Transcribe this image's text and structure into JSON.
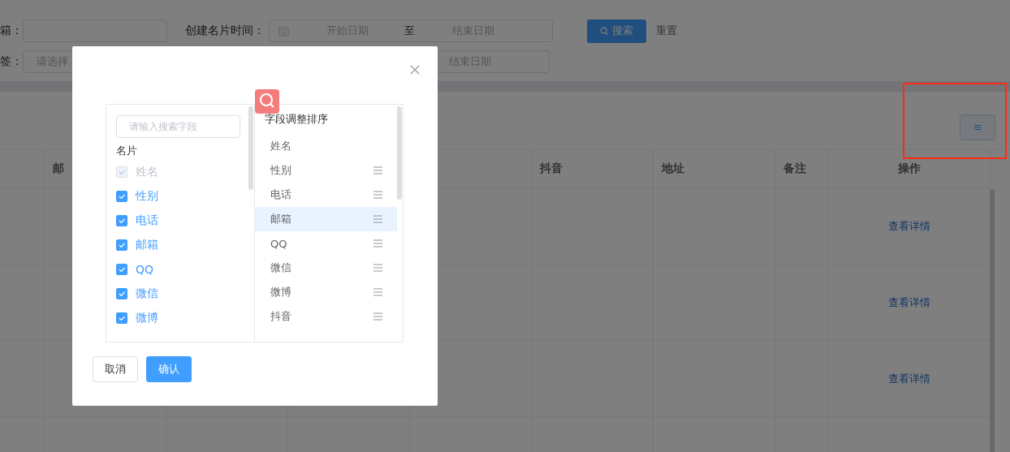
{
  "filters": {
    "row_1": [
      {
        "kind": "input",
        "label": "箱："
      },
      {
        "kind": "daterange",
        "label": "创建名片时间：",
        "start": "开始日期",
        "separator": "至",
        "end": "结束日期"
      }
    ],
    "row_2": [
      {
        "kind": "select",
        "label": "签：",
        "placeholder": "请选择"
      },
      {
        "kind": "daterange",
        "end": "结束日期"
      }
    ],
    "search_button": "搜索",
    "reset_link": "重置"
  },
  "table": {
    "columns": [
      {},
      {
        "label": "邮"
      },
      {},
      {},
      {},
      {
        "label": "抖音"
      },
      {
        "label": "地址"
      },
      {
        "label": "备注"
      },
      {
        "label": "操作"
      }
    ],
    "rows": [
      {
        "action": "查看详情"
      },
      {
        "action": "查看详情"
      },
      {
        "action": "查看详情"
      }
    ]
  },
  "dialog": {
    "left": {
      "search_placeholder": "请输入搜索字段",
      "group": "名片",
      "items": [
        {
          "label": "姓名",
          "checked": true,
          "disabled": true
        },
        {
          "label": "性别",
          "checked": true,
          "disabled": false
        },
        {
          "label": "电话",
          "checked": true,
          "disabled": false
        },
        {
          "label": "邮箱",
          "checked": true,
          "disabled": false
        },
        {
          "label": "QQ",
          "checked": true,
          "disabled": false
        },
        {
          "label": "微信",
          "checked": true,
          "disabled": false
        },
        {
          "label": "微博",
          "checked": true,
          "disabled": false
        }
      ]
    },
    "right": {
      "title": "字段调整排序",
      "items": [
        {
          "label": "姓名",
          "draggable": false,
          "selected": false
        },
        {
          "label": "性别",
          "draggable": true,
          "selected": false
        },
        {
          "label": "电话",
          "draggable": true,
          "selected": false
        },
        {
          "label": "邮箱",
          "draggable": true,
          "selected": true
        },
        {
          "label": "QQ",
          "draggable": true,
          "selected": false
        },
        {
          "label": "微信",
          "draggable": true,
          "selected": false
        },
        {
          "label": "微博",
          "draggable": true,
          "selected": false
        },
        {
          "label": "抖音",
          "draggable": true,
          "selected": false
        }
      ]
    },
    "buttons": [
      {
        "label": "取消",
        "kind": "default"
      },
      {
        "label": "确认",
        "kind": "primary"
      }
    ]
  }
}
